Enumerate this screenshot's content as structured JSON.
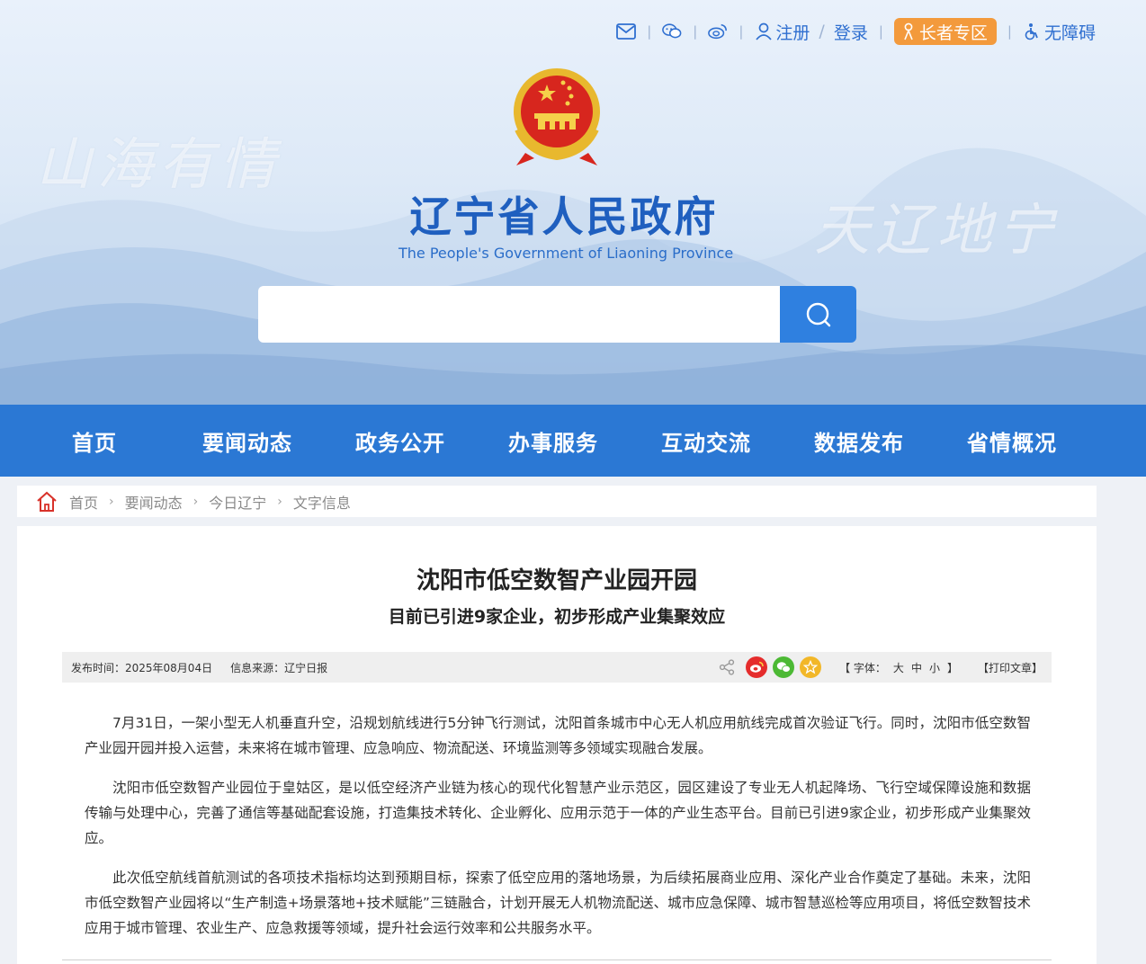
{
  "toplinks": {
    "register": "注册",
    "login": "登录",
    "slash": "/",
    "elder": "长者专区",
    "accessibility": "无障碍"
  },
  "banner": {
    "title": "辽宁省人民政府",
    "subtitle": "The People's Government of Liaoning Province",
    "calligraphy_left": "山海有情",
    "calligraphy_right": "天辽地宁"
  },
  "search": {
    "placeholder": ""
  },
  "nav": [
    "首页",
    "要闻动态",
    "政务公开",
    "办事服务",
    "互动交流",
    "数据发布",
    "省情概况"
  ],
  "breadcrumb": [
    "首页",
    "要闻动态",
    "今日辽宁",
    "文字信息"
  ],
  "article": {
    "title": "沈阳市低空数智产业园开园",
    "subtitle": "目前已引进9家企业，初步形成产业集聚效应",
    "publish_time": "发布时间：2025年08月04日",
    "source": "信息来源：辽宁日报",
    "font_label": "【 字体：",
    "font_large": "大",
    "font_medium": "中",
    "font_small": "小",
    "font_end": "】",
    "print": "【打印文章】",
    "paragraphs": [
      "7月31日，一架小型无人机垂直升空，沿规划航线进行5分钟飞行测试，沈阳首条城市中心无人机应用航线完成首次验证飞行。同时，沈阳市低空数智产业园开园并投入运营，未来将在城市管理、应急响应、物流配送、环境监测等多领域实现融合发展。",
      "沈阳市低空数智产业园位于皇姑区，是以低空经济产业链为核心的现代化智慧产业示范区，园区建设了专业无人机起降场、飞行空域保障设施和数据传输与处理中心，完善了通信等基础配套设施，打造集技术转化、企业孵化、应用示范于一体的产业生态平台。目前已引进9家企业，初步形成产业集聚效应。",
      "此次低空航线首航测试的各项技术指标均达到预期目标，探索了低空应用的落地场景，为后续拓展商业应用、深化产业合作奠定了基础。未来，沈阳市低空数智产业园将以“生产制造+场景落地+技术赋能”三链融合，计划开展无人机物流配送、城市应急保障、城市智慧巡检等应用项目，将低空数智技术应用于城市管理、农业生产、应急救援等领域，提升社会运行效率和公共服务水平。"
    ]
  },
  "colors": {
    "primary": "#2b78d4",
    "title_blue": "#1f5fbf",
    "elder_orange": "#f39a3c",
    "weibo_red": "#e52c2c",
    "wechat_green": "#4cb934",
    "fav_gold": "#f2b728"
  }
}
